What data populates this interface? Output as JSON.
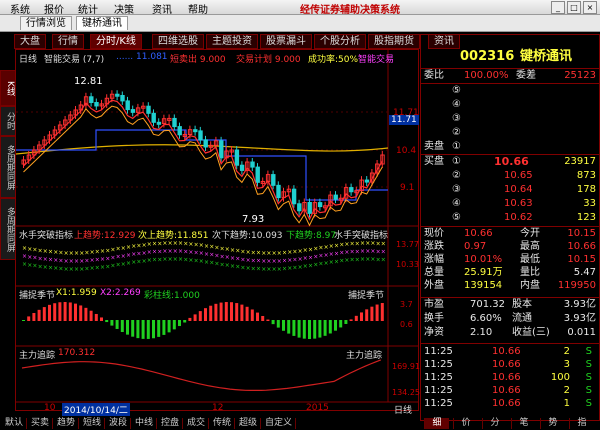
{
  "menubar": {
    "items": [
      "系统",
      "报价",
      "统计",
      "决策",
      "资讯",
      "帮助"
    ],
    "app_title": "经传证券辅助决策系统"
  },
  "doc_tabs": [
    "行情浏览",
    "键桥通讯"
  ],
  "view_tabs": [
    "大盘",
    "行情",
    "分时/K线",
    "四维选股",
    "主题投资",
    "股票漏斗",
    "个股分析",
    "股指期货",
    "资讯"
  ],
  "side_tabs": [
    "K线",
    "分时",
    "多周期同屏",
    "多周期同屏"
  ],
  "kline_header": {
    "period": "日线",
    "indicator": "智能交易 (7,7)",
    "params": "...... 11.081 ...",
    "sell_label": "短卖出 9.000",
    "plan_label": "交易计划 9.000",
    "success_label": "成功率:50%",
    "smart_label": "智能交易"
  },
  "kline": {
    "high_label": "12.81",
    "low_label": "7.93",
    "price_axis": [
      "11.71",
      "10.4",
      "9.1"
    ],
    "current_price": "11.71"
  },
  "pane2": {
    "title": "水手突破指标",
    "up": "上趋势:12.929",
    "sub_up": "次上趋势:11.851",
    "sub_down": "次下趋势:10.093",
    "down": "下趋势:8.97",
    "right_title": "水手突破指标",
    "ticks": [
      "13.77",
      "10.33"
    ]
  },
  "pane3": {
    "title": "捕捉季节",
    "x1": "X1:1.959",
    "x2": "X2:2.269",
    "extra": "彩柱线:1.000",
    "right_title": "捕捉季节",
    "ticks": [
      "3.7",
      "0.6"
    ]
  },
  "pane4": {
    "title": "主力追踪",
    "value": "170.312",
    "right_title": "主力追踪",
    "ticks": [
      "169.91",
      "134.25"
    ]
  },
  "xaxis": {
    "labels": [
      "10",
      "2014/10/14/二",
      "12",
      "2015"
    ],
    "mode": "日线"
  },
  "quote": {
    "code": "002316",
    "name": "键桥通讯",
    "weibi_label": "委比",
    "weibi": "100.00%",
    "weicha_label": "委差",
    "weicha": "25123",
    "sell_label": "卖盘",
    "buy_label": "买盘",
    "sells": [
      "⑤",
      "④",
      "③",
      "②",
      "①"
    ],
    "buys": [
      {
        "idx": "①",
        "price": "10.66",
        "vol": "23917"
      },
      {
        "idx": "②",
        "price": "10.65",
        "vol": "873"
      },
      {
        "idx": "③",
        "price": "10.64",
        "vol": "178"
      },
      {
        "idx": "④",
        "price": "10.63",
        "vol": "33"
      },
      {
        "idx": "⑤",
        "price": "10.62",
        "vol": "123"
      }
    ],
    "stats": [
      {
        "l1": "现价",
        "v1": "10.66",
        "l2": "今开",
        "v2": "10.15"
      },
      {
        "l1": "涨跌",
        "v1": "0.97",
        "l2": "最高",
        "v2": "10.66"
      },
      {
        "l1": "涨幅",
        "v1": "10.01%",
        "l2": "最低",
        "v2": "10.15"
      },
      {
        "l1": "总量",
        "v1": "25.91万",
        "l2": "量比",
        "v2": "5.47"
      },
      {
        "l1": "外盘",
        "v1": "139154",
        "l2": "内盘",
        "v2": "119950"
      }
    ],
    "fin": [
      {
        "l1": "市盈",
        "v1": "701.32",
        "l2": "股本",
        "v2": "3.93亿"
      },
      {
        "l1": "换手",
        "v1": "6.60%",
        "l2": "流通",
        "v2": "3.93亿"
      },
      {
        "l1": "净资",
        "v1": "2.10",
        "l2": "收益(三)",
        "v2": "0.011"
      }
    ],
    "ticks": [
      {
        "t": "11:25",
        "p": "10.66",
        "v": "2",
        "s": "S"
      },
      {
        "t": "11:25",
        "p": "10.66",
        "v": "3",
        "s": "S"
      },
      {
        "t": "11:25",
        "p": "10.66",
        "v": "100",
        "s": "S"
      },
      {
        "t": "11:25",
        "p": "10.66",
        "v": "2",
        "s": "S"
      },
      {
        "t": "11:25",
        "p": "10.66",
        "v": "1",
        "s": "S"
      }
    ]
  },
  "bottom_tabs": [
    "默认",
    "买卖",
    "趋势",
    "短线",
    "波段",
    "中线",
    "控盘",
    "成交",
    "传统",
    "超级",
    "自定义"
  ],
  "right_bottom_tabs": [
    "细",
    "价",
    "分",
    "笔",
    "势",
    "指"
  ],
  "colors": {
    "up": "#ff3030",
    "down": "#20d020",
    "frame": "#800000"
  }
}
